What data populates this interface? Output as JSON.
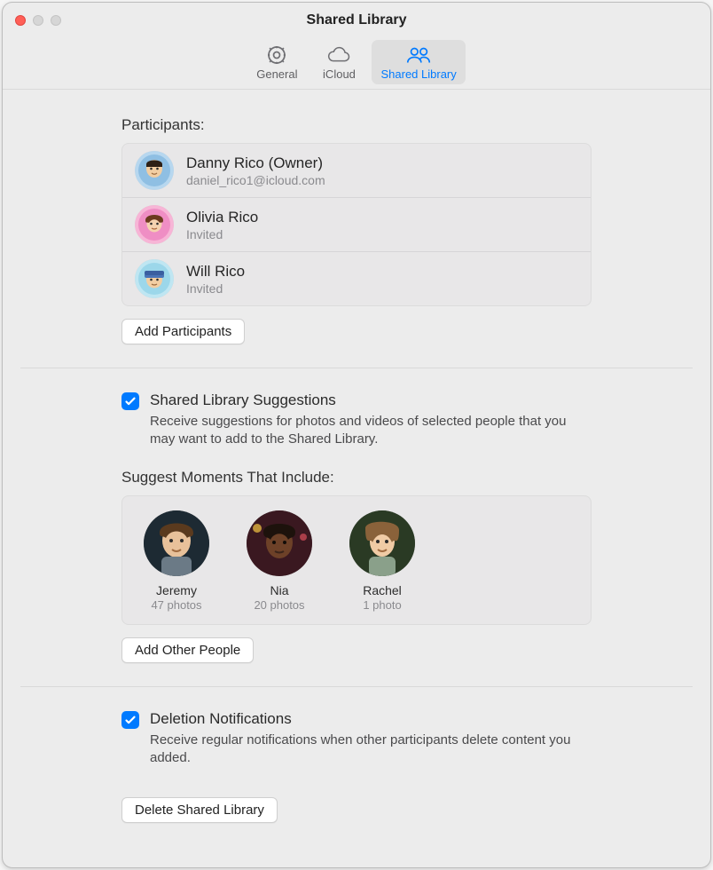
{
  "window": {
    "title": "Shared Library"
  },
  "toolbar": {
    "items": [
      {
        "label": "General"
      },
      {
        "label": "iCloud"
      },
      {
        "label": "Shared Library"
      }
    ],
    "active_index": 2
  },
  "participants": {
    "heading": "Participants:",
    "rows": [
      {
        "name": "Danny Rico (Owner)",
        "sub": "daniel_rico1@icloud.com"
      },
      {
        "name": "Olivia Rico",
        "sub": "Invited"
      },
      {
        "name": "Will Rico",
        "sub": "Invited"
      }
    ],
    "add_button": "Add Participants"
  },
  "suggestions": {
    "checkbox_label": "Shared Library Suggestions",
    "checked": true,
    "description": "Receive suggestions for photos and videos of selected people that you may want to add to the Shared Library.",
    "subheading": "Suggest Moments That Include:",
    "people": [
      {
        "name": "Jeremy",
        "sub": "47 photos"
      },
      {
        "name": "Nia",
        "sub": "20 photos"
      },
      {
        "name": "Rachel",
        "sub": "1 photo"
      }
    ],
    "add_people_button": "Add Other People"
  },
  "deletion": {
    "checkbox_label": "Deletion Notifications",
    "checked": true,
    "description": "Receive regular notifications when other participants delete content you added."
  },
  "footer": {
    "delete_button": "Delete Shared Library"
  }
}
